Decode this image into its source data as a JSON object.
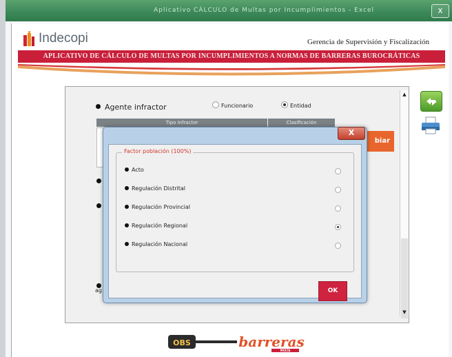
{
  "window": {
    "title": "Aplicativo CÁLCULO de Multas por Incumplimientos - Excel",
    "close_glyph": "x"
  },
  "header": {
    "logo_text": "Indecopi",
    "department": "Gerencia de Supervisión y Fiscalización",
    "banner": "APLICATIVO DE CÁLCULO DE MULTAS POR INCUMPLIMIENTOS A NORMAS DE BARRERAS BUROCRÁTICAS"
  },
  "main": {
    "agente_label": "Agente infractor",
    "agente_options": [
      {
        "label": "Funcionario",
        "selected": false
      },
      {
        "label": "Entidad",
        "selected": true
      }
    ],
    "table_headers": [
      "Tipo infractor",
      "Clasificación"
    ],
    "cambiar_label": "biar",
    "side_fragment": "ag"
  },
  "toolbar": {
    "refresh_icon": "refresh-icon",
    "print_icon": "printer-icon"
  },
  "dialog": {
    "close_glyph": "X",
    "group_title": "Factor población (100%)",
    "options": [
      {
        "label": "Acto",
        "selected": false
      },
      {
        "label": "Regulación Distrital",
        "selected": false
      },
      {
        "label": "Regulación Provincial",
        "selected": false
      },
      {
        "label": "Regulación Regional",
        "selected": true
      },
      {
        "label": "Regulación Nacional",
        "selected": false
      }
    ],
    "ok_label": "OK"
  },
  "footer": {
    "logo_left": "OBS",
    "logo_right": "barreras",
    "logo_sub": "MULTA"
  },
  "colors": {
    "brand_red": "#c91f3a",
    "accent_orange": "#e8662c",
    "title_green": "#3e8a5a"
  }
}
